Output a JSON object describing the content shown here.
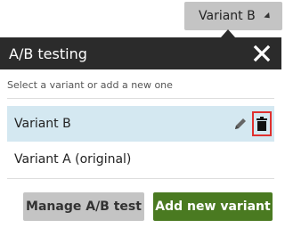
{
  "variant_selector": {
    "label": "Variant B",
    "icon": "chevron-down-icon"
  },
  "panel": {
    "title": "A/B testing",
    "subtitle": "Select a variant or add a new one",
    "variants": [
      {
        "label": "Variant B",
        "selected": true
      },
      {
        "label": "Variant A (original)",
        "selected": false
      }
    ]
  },
  "buttons": {
    "manage": "Manage A/B test",
    "add": "Add new variant"
  },
  "colors": {
    "header_bg": "#2b2b2b",
    "selected_row_bg": "#d4e8f1",
    "primary_button": "#4a7a21",
    "secondary_button": "#c4c4c4",
    "highlight_border": "#e0312f"
  }
}
